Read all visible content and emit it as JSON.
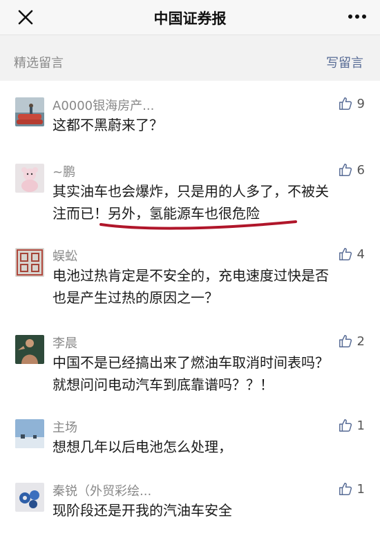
{
  "header": {
    "title": "中国证券报",
    "close_icon": "close-icon",
    "more_icon": "more-icon"
  },
  "section": {
    "label": "精选留言",
    "write_label": "写留言"
  },
  "comments": [
    {
      "nickname": "A0000银海房产...",
      "likes": "9",
      "text": "这都不黑蔚来了？"
    },
    {
      "nickname": "~鹏",
      "likes": "6",
      "text_line1": "其实油车也会爆炸，只是用的人多了，不被关",
      "text_line2_a": "注而已！",
      "text_line2_b": "另外，氢能源车也很危险"
    },
    {
      "nickname": "蜈蚣",
      "likes": "4",
      "text_line1": "电池过热肯定是不安全的，充电速度过快是否",
      "text_line2": "也是产生过热的原因之一？"
    },
    {
      "nickname": "李晨",
      "likes": "2",
      "text_line1": "中国不是已经搞出来了燃油车取消时间表吗？",
      "text_line2": "就想问问电动汽车到底靠谱吗？？！"
    },
    {
      "nickname": "主场",
      "likes": "1",
      "text": "想想几年以后电池怎么处理，"
    },
    {
      "nickname": "秦锐（外贸彩绘...",
      "likes": "1",
      "text": "现阶段还是开我的汽油车安全"
    }
  ],
  "colors": {
    "link": "#576b95",
    "underline": "#b0162a",
    "nickname": "#888888"
  }
}
